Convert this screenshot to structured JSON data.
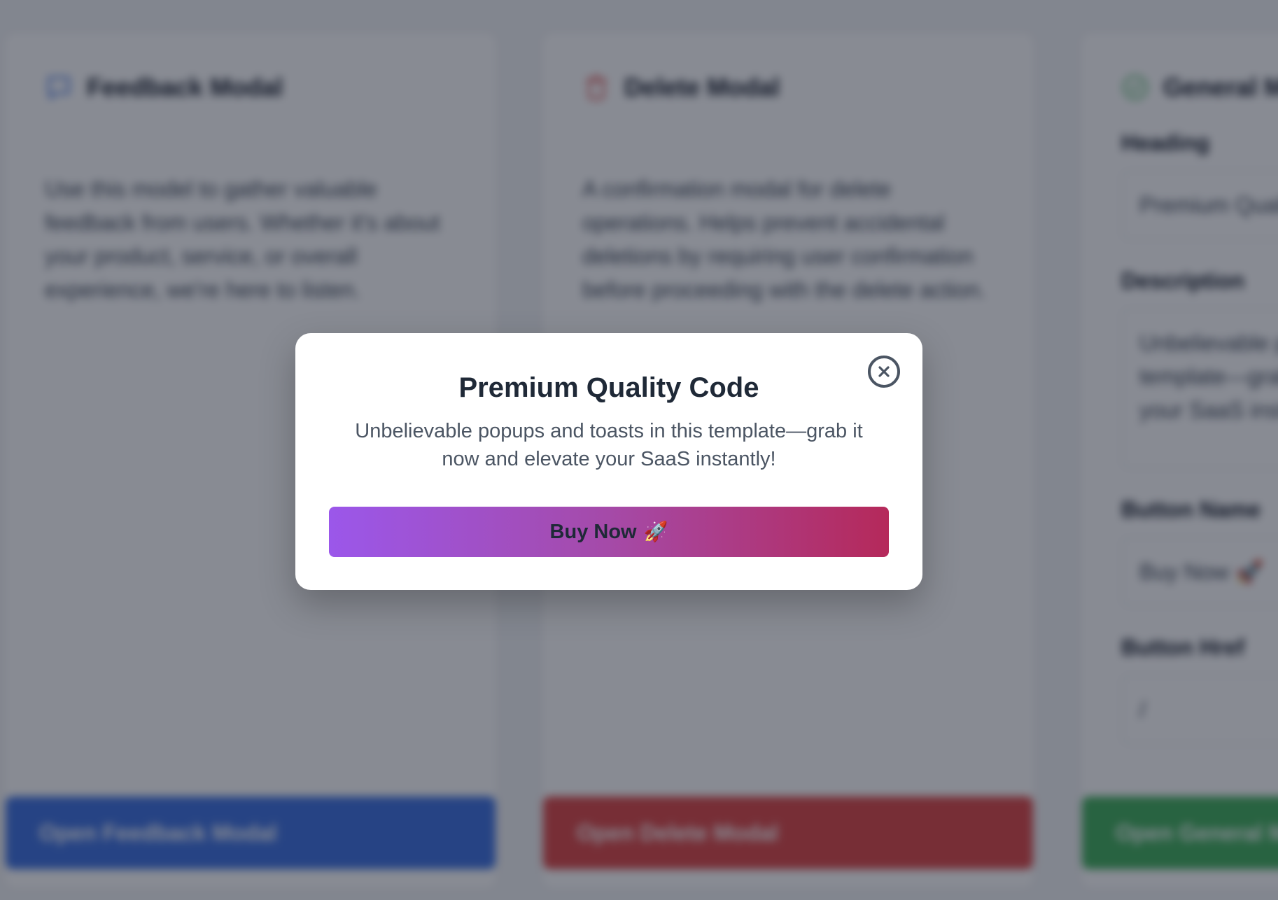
{
  "background": {
    "cards": [
      {
        "title": "Feedback Modal",
        "icon": "chat-bubble-icon",
        "description": "Use this model to gather valuable feedback from users. Whether it's about your product, service, or overall experience, we're here to listen.",
        "button_label": "Open Feedback Modal",
        "accent": "#3b6fe0"
      },
      {
        "title": "Delete Modal",
        "icon": "trash-icon",
        "description": "A confirmation modal for delete operations. Helps prevent accidental deletions by requiring user confirmation before proceeding with the delete action.",
        "button_label": "Open Delete Modal",
        "accent": "#dc4545"
      },
      {
        "title": "General Modal",
        "icon": "check-circle-icon",
        "form": {
          "heading_label": "Heading",
          "heading_value": "Premium Quality Code",
          "description_label": "Description",
          "description_value": "Unbelievable popups and toasts in this template—grab it now and elevate your SaaS instantly!",
          "button_name_label": "Button Name",
          "button_name_value": "Buy Now 🚀",
          "button_href_label": "Button Href",
          "button_href_value": "/"
        },
        "button_label": "Open General Modal",
        "accent": "#3fae5a"
      }
    ]
  },
  "modal": {
    "title": "Premium Quality Code",
    "description": "Unbelievable popups and toasts in this template—grab it now and elevate your SaaS instantly!",
    "cta_label": "Buy Now",
    "cta_emoji": "🚀",
    "close_icon": "close-circle-icon",
    "gradient_start": "#9b57ea",
    "gradient_end": "#b5295a"
  }
}
